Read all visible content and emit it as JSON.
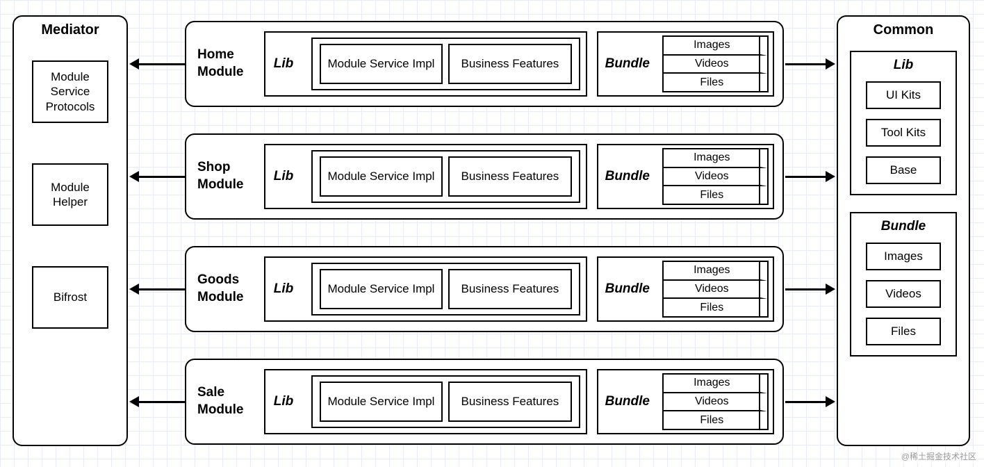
{
  "mediator": {
    "title": "Mediator",
    "items": [
      "Module Service Protocols",
      "Module Helper",
      "Bifrost"
    ]
  },
  "common": {
    "title": "Common",
    "lib": {
      "label": "Lib",
      "items": [
        "UI Kits",
        "Tool Kits",
        "Base"
      ]
    },
    "bundle": {
      "label": "Bundle",
      "items": [
        "Images",
        "Videos",
        "Files"
      ]
    }
  },
  "modules": [
    {
      "name": "Home Module",
      "lib_label": "Lib",
      "lib_items": [
        "Module Service Impl",
        "Business Features"
      ],
      "bundle_label": "Bundle",
      "bundle_items": [
        "Images",
        "Videos",
        "Files"
      ]
    },
    {
      "name": "Shop Module",
      "lib_label": "Lib",
      "lib_items": [
        "Module Service Impl",
        "Business Features"
      ],
      "bundle_label": "Bundle",
      "bundle_items": [
        "Images",
        "Videos",
        "Files"
      ]
    },
    {
      "name": "Goods Module",
      "lib_label": "Lib",
      "lib_items": [
        "Module Service Impl",
        "Business Features"
      ],
      "bundle_label": "Bundle",
      "bundle_items": [
        "Images",
        "Videos",
        "Files"
      ]
    },
    {
      "name": "Sale Module",
      "lib_label": "Lib",
      "lib_items": [
        "Module Service Impl",
        "Business Features"
      ],
      "bundle_label": "Bundle",
      "bundle_items": [
        "Images",
        "Videos",
        "Files"
      ]
    }
  ],
  "watermark": "@稀土掘金技术社区"
}
